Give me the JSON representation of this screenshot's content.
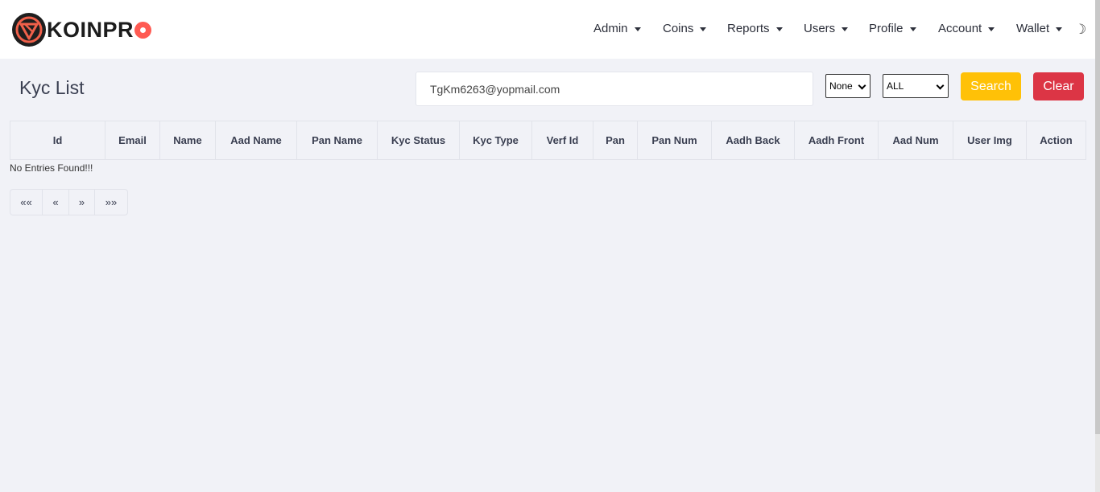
{
  "brand": {
    "name": "KOINPR"
  },
  "nav": {
    "items": [
      {
        "label": "Admin"
      },
      {
        "label": "Coins"
      },
      {
        "label": "Reports"
      },
      {
        "label": "Users"
      },
      {
        "label": "Profile"
      },
      {
        "label": "Account"
      },
      {
        "label": "Wallet"
      }
    ],
    "theme_icon": "☽"
  },
  "page": {
    "title": "Kyc List"
  },
  "filters": {
    "search_value": "TgKm6263@yopmail.com",
    "select_one": "None",
    "select_two": "ALL",
    "search_label": "Search",
    "clear_label": "Clear"
  },
  "table": {
    "columns": [
      "Id",
      "Email",
      "Name",
      "Aad Name",
      "Pan Name",
      "Kyc Status",
      "Kyc Type",
      "Verf Id",
      "Pan",
      "Pan Num",
      "Aadh Back",
      "Aadh Front",
      "Aad Num",
      "User Img",
      "Action"
    ],
    "empty_message": "No Entries Found!!!"
  },
  "pagination": {
    "first": "«« ",
    "prev": "«",
    "next": "»",
    "last": "»»"
  },
  "colors": {
    "search_button": "#ffc107",
    "clear_button": "#dc3545",
    "background": "#f1f2f7"
  }
}
